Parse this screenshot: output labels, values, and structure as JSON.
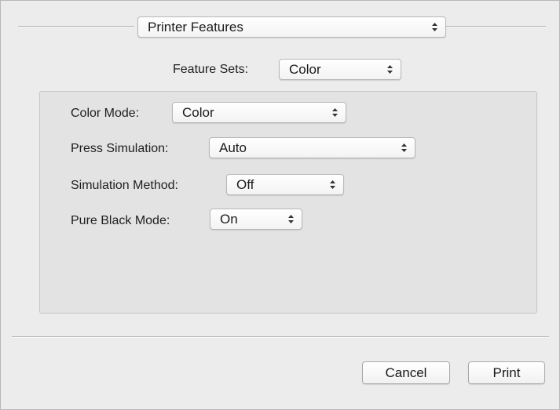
{
  "header": {
    "panel_select_value": "Printer Features"
  },
  "feature_sets": {
    "label": "Feature Sets:",
    "value": "Color"
  },
  "settings": {
    "color_mode": {
      "label": "Color Mode:",
      "value": "Color"
    },
    "press_simulation": {
      "label": "Press Simulation:",
      "value": "Auto"
    },
    "simulation_method": {
      "label": "Simulation Method:",
      "value": "Off"
    },
    "pure_black_mode": {
      "label": "Pure Black Mode:",
      "value": "On"
    }
  },
  "buttons": {
    "cancel": "Cancel",
    "print": "Print"
  }
}
